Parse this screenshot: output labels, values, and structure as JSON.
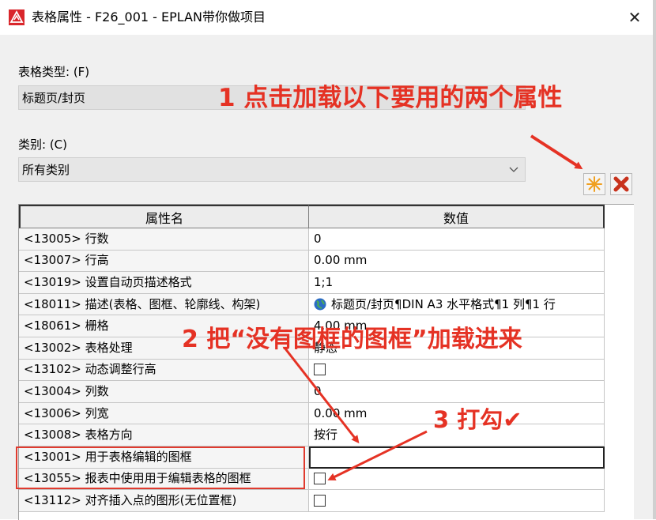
{
  "window": {
    "title": "表格属性 - F26_001 - EPLAN带你做项目",
    "close_glyph": "✕"
  },
  "form": {
    "table_type_label": "表格类型: (F)",
    "table_type_value": "标题页/封页",
    "category_label": "类别: (C)",
    "category_value": "所有类别"
  },
  "toolbar": {
    "new_icon": "sun-star-icon",
    "delete_icon": "red-x-icon"
  },
  "table": {
    "columns": [
      "属性名",
      "数值"
    ],
    "rows": [
      {
        "name": "<13005> 行数",
        "value": "0",
        "type": "text"
      },
      {
        "name": "<13007> 行高",
        "value": "0.00 mm",
        "type": "text"
      },
      {
        "name": "<13019> 设置自动页描述格式",
        "value": "1;1",
        "type": "text"
      },
      {
        "name": "<18011> 描述(表格、图框、轮廓线、构架)",
        "value": "标题页/封页¶DIN A3 水平格式¶1 列¶1 行",
        "type": "globe"
      },
      {
        "name": "<18061> 栅格",
        "value": "4.00 mm",
        "type": "text"
      },
      {
        "name": "<13002> 表格处理",
        "value": "静态",
        "type": "text"
      },
      {
        "name": "<13102> 动态调整行高",
        "value": "",
        "type": "checkbox"
      },
      {
        "name": "<13004> 列数",
        "value": "0",
        "type": "text"
      },
      {
        "name": "<13006> 列宽",
        "value": "0.00 mm",
        "type": "text"
      },
      {
        "name": "<13008> 表格方向",
        "value": "按行",
        "type": "text"
      },
      {
        "name": "<13001> 用于表格编辑的图框",
        "value": "",
        "type": "editing"
      },
      {
        "name": "<13055> 报表中使用用于编辑表格的图框",
        "value": "",
        "type": "checkbox"
      },
      {
        "name": "<13112> 对齐插入点的图形(无位置框)",
        "value": "",
        "type": "checkbox"
      }
    ]
  },
  "annotations": {
    "step1": "1 点击加载以下要用的两个属性",
    "step2": "2 把“没有图框的图框”加载进来",
    "step3": "3 打勾✔",
    "color": "#e53224"
  }
}
